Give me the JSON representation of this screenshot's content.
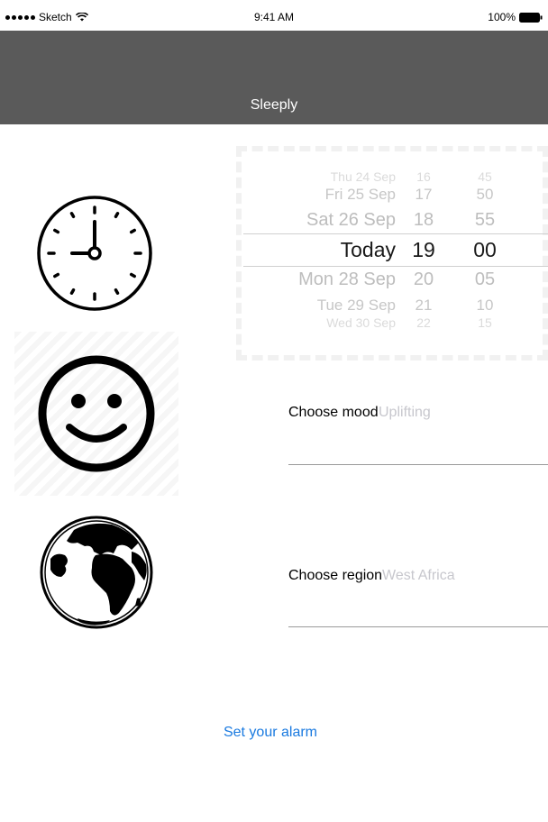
{
  "status_bar": {
    "carrier": "Sketch",
    "time": "9:41 AM",
    "battery": "100%"
  },
  "nav": {
    "title": "Sleeply"
  },
  "icons": {
    "clock": "clock-icon",
    "mood": "smiley-face-icon",
    "region": "globe-icon"
  },
  "date_picker": {
    "rows": [
      {
        "date": "Thu 24 Sep",
        "hour": "16",
        "minute": "45"
      },
      {
        "date": "Fri 25 Sep",
        "hour": "17",
        "minute": "50"
      },
      {
        "date": "Sat 26 Sep",
        "hour": "18",
        "minute": "55"
      },
      {
        "date": "Today",
        "hour": "19",
        "minute": "00"
      },
      {
        "date": "Mon 28 Sep",
        "hour": "20",
        "minute": "05"
      },
      {
        "date": "Tue 29 Sep",
        "hour": "21",
        "minute": "10"
      },
      {
        "date": "Wed 30 Sep",
        "hour": "22",
        "minute": "15"
      }
    ],
    "selected_index": 3
  },
  "mood_field": {
    "label": "Choose mood",
    "placeholder": "Uplifting"
  },
  "region_field": {
    "label": "Choose region",
    "placeholder": "West Africa"
  },
  "alarm_button": {
    "label": "Set your alarm"
  },
  "colors": {
    "nav_background": "#5a5a5a",
    "accent": "#1a7ae0"
  }
}
